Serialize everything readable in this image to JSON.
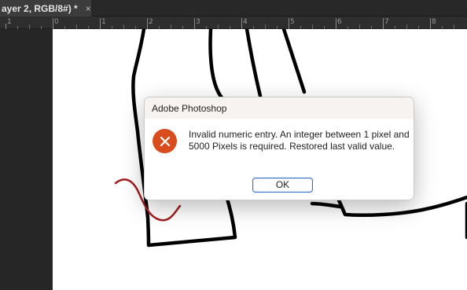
{
  "document_tab": {
    "title": "ayer 2, RGB/8#) *",
    "close_glyph": "×"
  },
  "ruler": {
    "labels": [
      "1",
      "0",
      "1",
      "2",
      "3",
      "4",
      "5",
      "6",
      "7",
      "8"
    ]
  },
  "dialog": {
    "title": "Adobe Photoshop",
    "message": "Invalid numeric entry. An integer between 1 pixel and 5000 Pixels is required. Restored last valid value.",
    "ok_label": "OK",
    "icon": "error-icon"
  },
  "colors": {
    "error_icon": "#d94c1e",
    "button_border": "#2b6fc8",
    "stroke_red": "#a01e1e"
  }
}
